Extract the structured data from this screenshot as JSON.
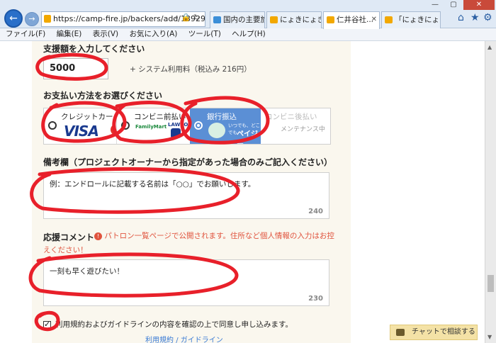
{
  "browser": {
    "url": "https://camp-fire.jp/backers/add/13929",
    "tabs": [
      {
        "label": "国内の主要旅...",
        "color": "#3c8fd8"
      },
      {
        "label": "にょきにょき 攻...",
        "color": "#f2a800"
      },
      {
        "label": "仁井谷社...",
        "color": "#f2a800",
        "active": true
      },
      {
        "label": "「にょきにょき 字...",
        "color": "#f2a800"
      }
    ],
    "menu": [
      "ファイル(F)",
      "編集(E)",
      "表示(V)",
      "お気に入り(A)",
      "ツール(T)",
      "ヘルプ(H)"
    ]
  },
  "form": {
    "amount_title": "支援額を入力してください",
    "amount_value": "5000",
    "fee_text": "+ システム利用料（税込み 216円）",
    "payment_title": "お支払い方法をお選びください",
    "payment": {
      "credit": "クレジットカード",
      "credit_logo": "VISA",
      "convenience": "コンビニ前払い",
      "familymart": "FamilyMart",
      "lawson": "LAWSON",
      "bank": "銀行振込",
      "payeasy_small": "いつでも、どこでも",
      "payeasy_big": "ペイジー",
      "later": "コンビニ後払い",
      "later_note": "メンテナンス中"
    },
    "note_title": "備考欄（プロジェクトオーナーから指定があった場合のみご記入ください）",
    "note_placeholder": "例：エンドロールに記載する名前は「○○」でお願いします。",
    "note_counter": "240",
    "comment_title": "応援コメント",
    "comment_warning_1": "パトロン一覧ページで公開されます。住所など個人情報の入力はお控",
    "comment_warning_2": "えください！",
    "comment_value": "一刻も早く遊びたい！",
    "comment_counter": "230",
    "agree_text": "利用規約およびガイドラインの内容を確認の上で同意し申し込みます。",
    "link_terms": "利用規約",
    "link_sep": "/",
    "link_guideline": "ガイドライン",
    "chat_label": "チャットで相談する"
  },
  "colors": {
    "annotation": "#e8202a",
    "selected_payment": "#5b8fd5",
    "warning": "#e0543e"
  }
}
